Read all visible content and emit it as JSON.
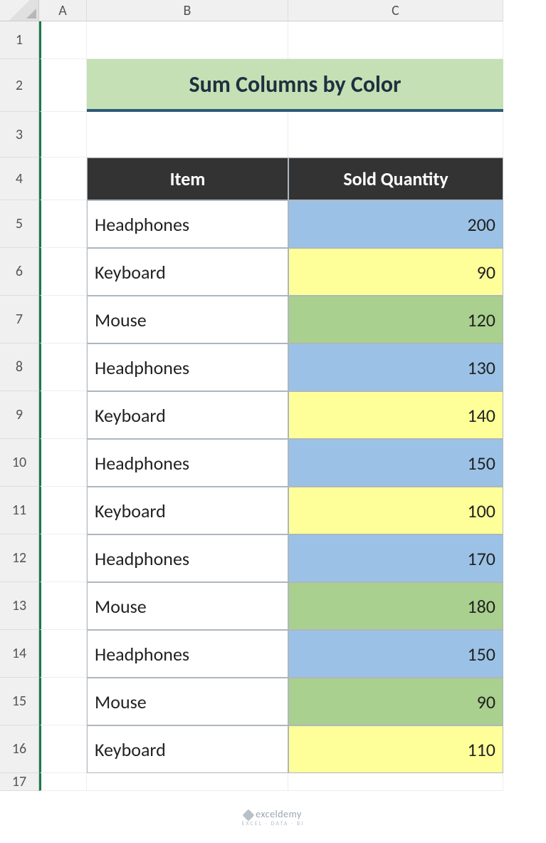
{
  "columns": [
    "A",
    "B",
    "C"
  ],
  "rowCount": 17,
  "title": "Sum Columns by Color",
  "headers": {
    "item": "Item",
    "qty": "Sold Quantity"
  },
  "rows": [
    {
      "item": "Headphones",
      "qty": "200",
      "color": "blue"
    },
    {
      "item": "Keyboard",
      "qty": "90",
      "color": "yellow"
    },
    {
      "item": "Mouse",
      "qty": "120",
      "color": "green"
    },
    {
      "item": "Headphones",
      "qty": "130",
      "color": "blue"
    },
    {
      "item": "Keyboard",
      "qty": "140",
      "color": "yellow"
    },
    {
      "item": "Headphones",
      "qty": "150",
      "color": "blue"
    },
    {
      "item": "Keyboard",
      "qty": "100",
      "color": "yellow"
    },
    {
      "item": "Headphones",
      "qty": "170",
      "color": "blue"
    },
    {
      "item": "Mouse",
      "qty": "180",
      "color": "green"
    },
    {
      "item": "Headphones",
      "qty": "150",
      "color": "blue"
    },
    {
      "item": "Mouse",
      "qty": "90",
      "color": "green"
    },
    {
      "item": "Keyboard",
      "qty": "110",
      "color": "yellow"
    }
  ],
  "watermark": {
    "main": "exceldemy",
    "sub": "EXCEL · DATA · BI"
  }
}
